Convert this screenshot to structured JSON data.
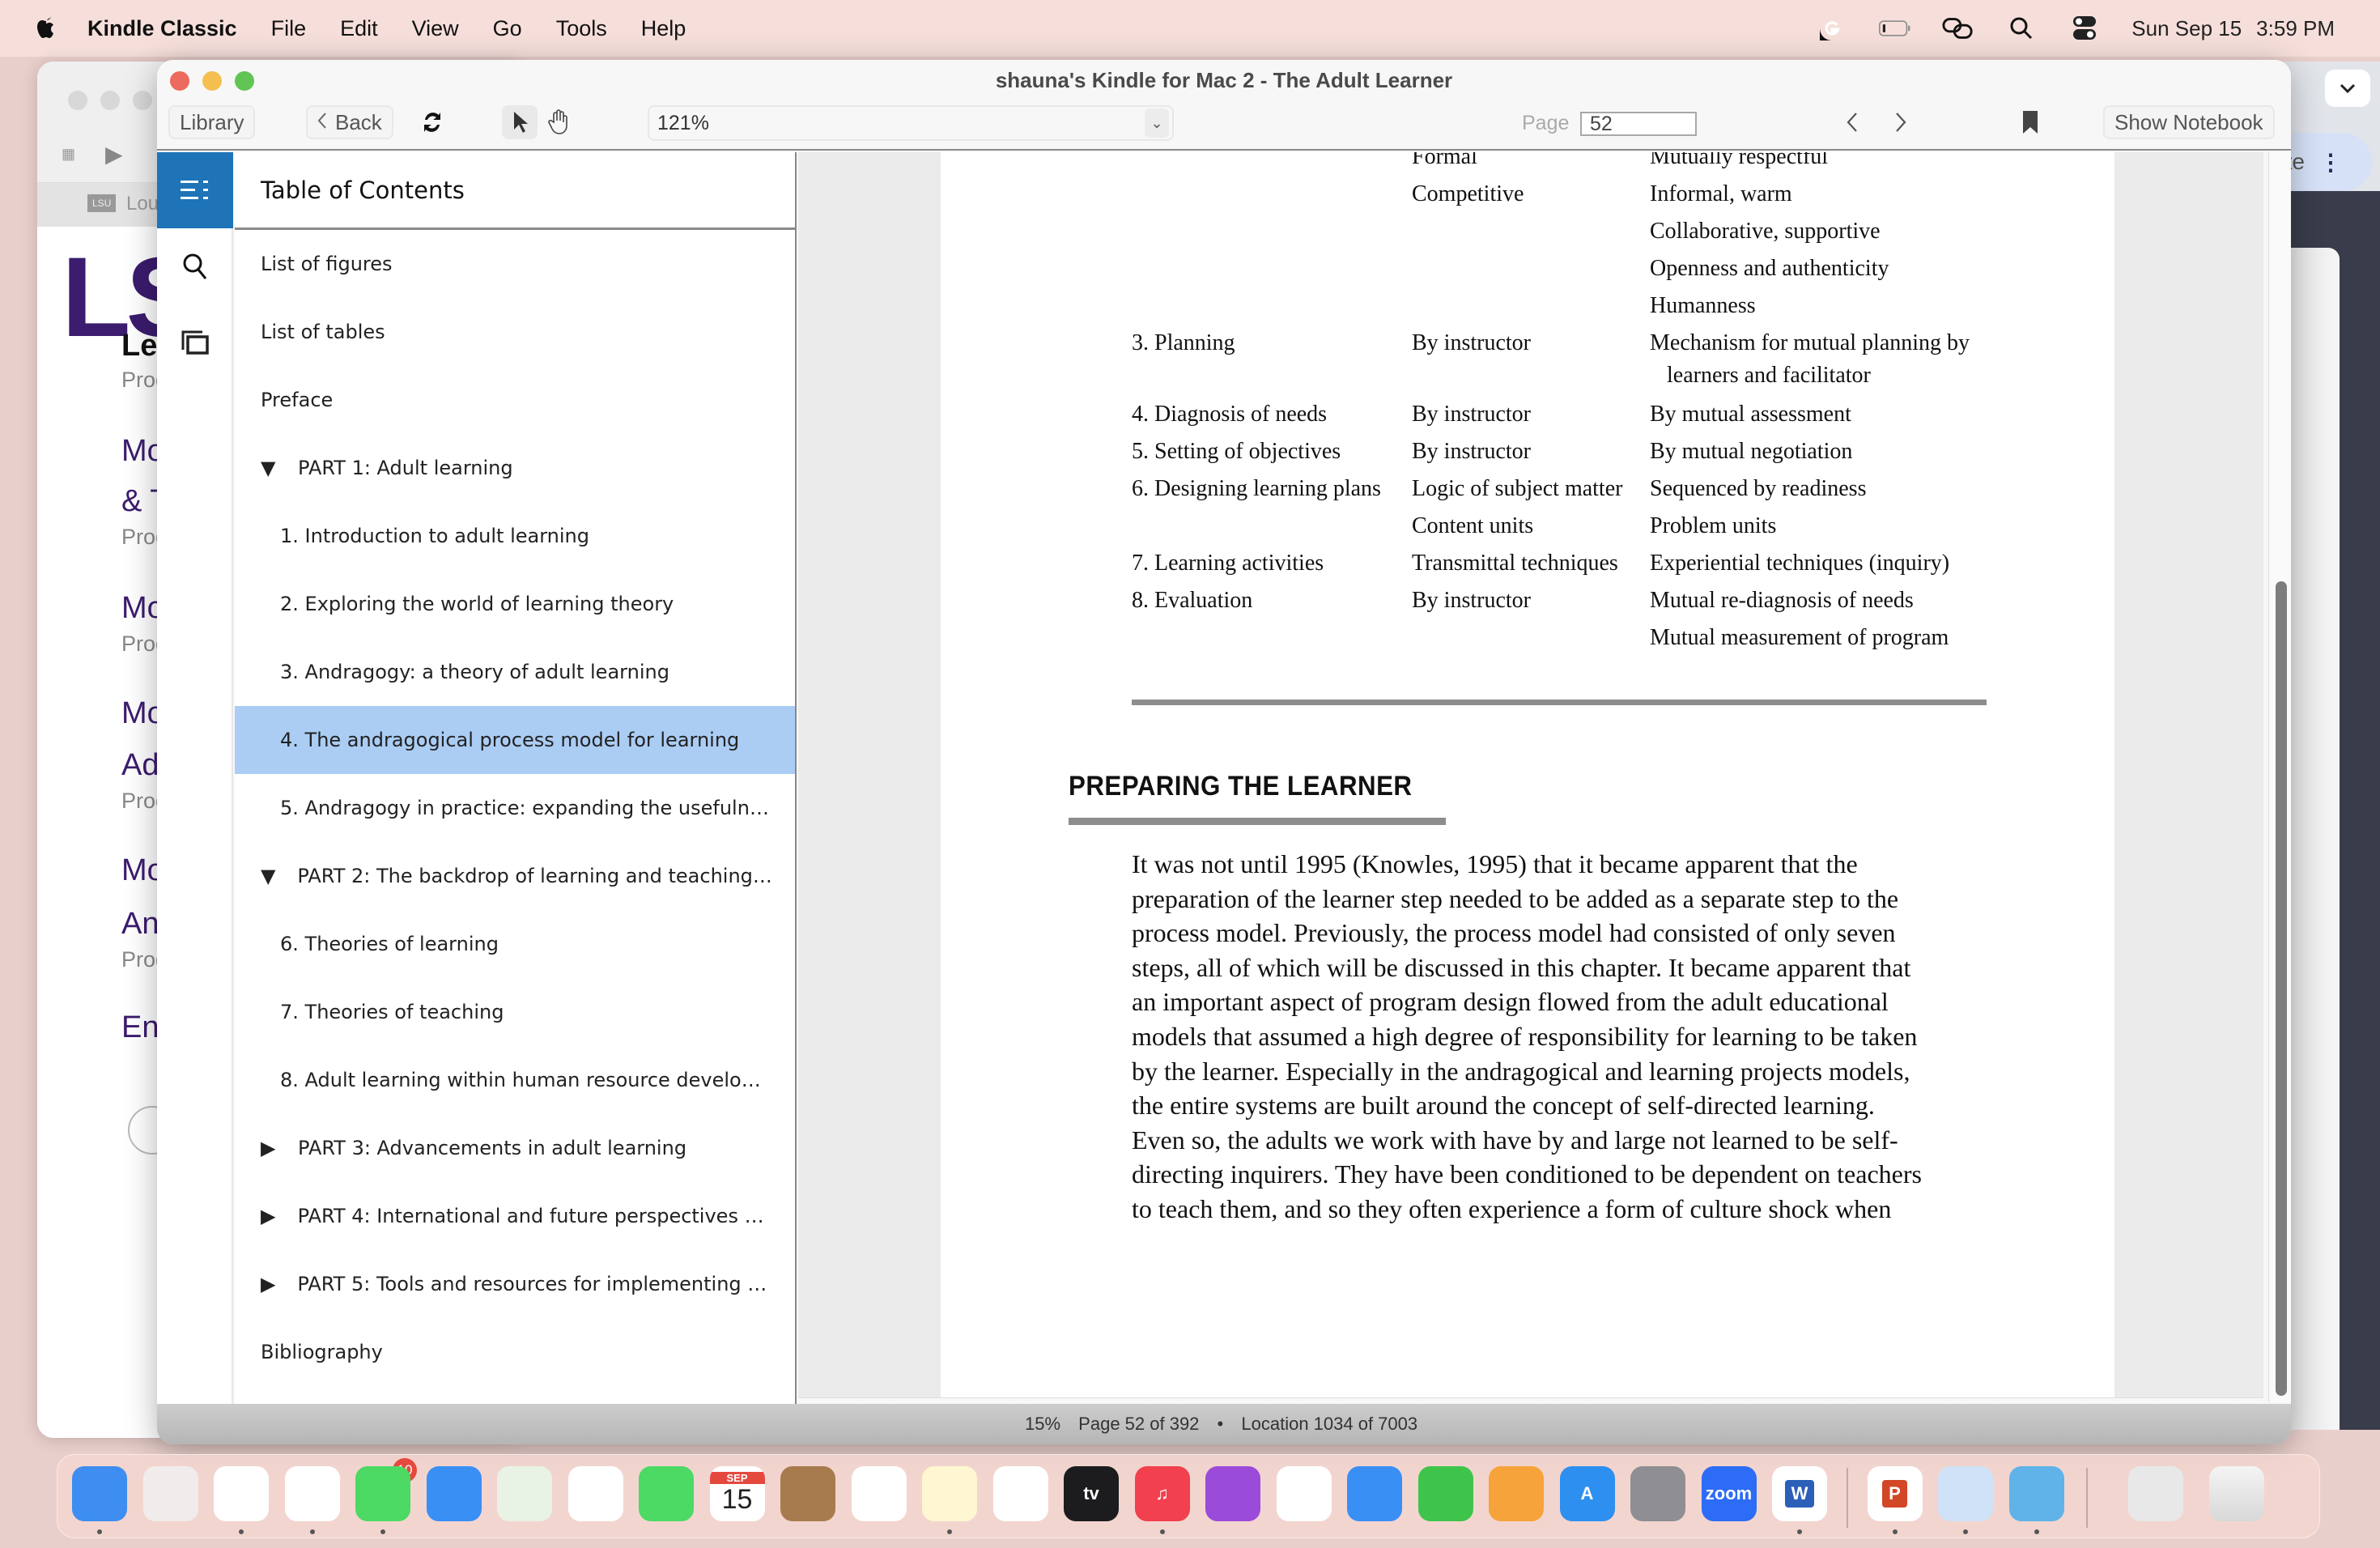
{
  "menubar": {
    "app_name": "Kindle Classic",
    "menus": [
      "File",
      "Edit",
      "View",
      "Go",
      "Tools",
      "Help"
    ],
    "status_icons": [
      "grammarly-icon",
      "battery-icon",
      "screen-mirror-icon",
      "spotlight-search-icon",
      "control-center-icon"
    ],
    "date": "Sun Sep 15",
    "time": "3:59 PM"
  },
  "background_window_left": {
    "tab_label": "Loui",
    "logo_text": "LS",
    "links": [
      {
        "title": "Le",
        "sub": "Prog"
      },
      {
        "title": "Mo",
        "sub": ""
      },
      {
        "title": "& T",
        "sub": "Prog"
      },
      {
        "title": "Mo",
        "sub": "Prog"
      },
      {
        "title": "Mo",
        "sub": ""
      },
      {
        "title": "Ad",
        "sub": "Prog"
      },
      {
        "title": "Mo",
        "sub": ""
      },
      {
        "title": "An",
        "sub": "Prog"
      },
      {
        "title": "En",
        "sub": ""
      }
    ]
  },
  "background_window_right": {
    "pill_text": "ate"
  },
  "window": {
    "title": "shauna's Kindle for Mac 2 - The Adult Learner"
  },
  "toolbar": {
    "library_label": "Library",
    "back_label": "Back",
    "zoom_value": "121%",
    "page_label": "Page",
    "page_value": "52",
    "show_notebook_label": "Show Notebook"
  },
  "toc": {
    "header": "Table of Contents",
    "items": [
      {
        "label": "List of figures",
        "level": 0,
        "toggle": ""
      },
      {
        "label": "List of tables",
        "level": 0,
        "toggle": ""
      },
      {
        "label": "Preface",
        "level": 0,
        "toggle": ""
      },
      {
        "label": "PART 1: Adult learning",
        "level": 0,
        "toggle": "▼"
      },
      {
        "label": "1. Introduction to adult learning",
        "level": 1,
        "toggle": ""
      },
      {
        "label": "2. Exploring the world of learning theory",
        "level": 1,
        "toggle": ""
      },
      {
        "label": "3. Andragogy: a theory of adult learning",
        "level": 1,
        "toggle": ""
      },
      {
        "label": "4. The andragogical process model for learning",
        "level": 1,
        "toggle": "",
        "selected": true
      },
      {
        "label": "5. Andragogy in practice: expanding the usefulne…",
        "level": 1,
        "toggle": ""
      },
      {
        "label": "PART 2: The backdrop of learning and teaching …",
        "level": 0,
        "toggle": "▼"
      },
      {
        "label": "6. Theories of learning",
        "level": 1,
        "toggle": ""
      },
      {
        "label": "7. Theories of teaching",
        "level": 1,
        "toggle": ""
      },
      {
        "label": "8. Adult learning within human resource develop…",
        "level": 1,
        "toggle": ""
      },
      {
        "label": "PART 3: Advancements in adult learning",
        "level": 0,
        "toggle": "▶"
      },
      {
        "label": "PART 4: International and future perspectives o…",
        "level": 0,
        "toggle": "▶"
      },
      {
        "label": "PART 5: Tools and resources for implementing a…",
        "level": 0,
        "toggle": "▶"
      },
      {
        "label": "Bibliography",
        "level": 0,
        "toggle": ""
      }
    ]
  },
  "page_content": {
    "table_rows": [
      {
        "c1": "",
        "c2": "Formal",
        "c3": "Mutually respectful"
      },
      {
        "c1": "",
        "c2": "Competitive",
        "c3": "Informal, warm"
      },
      {
        "c1": "",
        "c2": "",
        "c3": "Collaborative, supportive"
      },
      {
        "c1": "",
        "c2": "",
        "c3": "Openness and authenticity"
      },
      {
        "c1": "",
        "c2": "",
        "c3": "Humanness"
      },
      {
        "c1": "3. Planning",
        "c2": "By instructor",
        "c3": "Mechanism for mutual planning by"
      },
      {
        "c1": "",
        "c2": "",
        "c3": "   learners and facilitator"
      },
      {
        "c1": "4. Diagnosis of needs",
        "c2": "By instructor",
        "c3": "By mutual assessment"
      },
      {
        "c1": "5. Setting of objectives",
        "c2": "By instructor",
        "c3": "By mutual negotiation"
      },
      {
        "c1": "6. Designing learning plans",
        "c2": "Logic of subject matter",
        "c3": "Sequenced by readiness"
      },
      {
        "c1": "",
        "c2": "Content units",
        "c3": "Problem units"
      },
      {
        "c1": "7. Learning activities",
        "c2": "Transmittal techniques",
        "c3": "Experiential techniques (inquiry)"
      },
      {
        "c1": "8. Evaluation",
        "c2": "By instructor",
        "c3": "Mutual re-diagnosis of needs"
      },
      {
        "c1": "",
        "c2": "",
        "c3": "Mutual measurement of program"
      }
    ],
    "section_heading": "PREPARING THE LEARNER",
    "paragraph_lines": [
      "It was not until 1995 (Knowles, 1995) that it became apparent that the",
      "preparation of the learner step needed to be added as a separate step to the",
      "process model. Previously, the process model had consisted of only seven",
      "steps, all of which will be discussed in this chapter. It became apparent that",
      "an important aspect of program design flowed from the adult educational",
      "models that assumed a high degree of responsibility for learning to be taken",
      "by the learner. Especially in the andragogical and learning projects models,",
      "the entire systems are built around the concept of self-directed learning.",
      "Even so, the adults we work with have by and large not learned to be self-",
      "directing inquirers. They have been conditioned to be dependent on teachers",
      "to teach them, and so they often experience a form of culture shock when"
    ]
  },
  "status": {
    "percent": "15%",
    "page": "Page 52 of 392",
    "separator": "•",
    "location": "Location 1034 of 7003",
    "progress_fraction": 0.15
  },
  "colors": {
    "accent": "#1f73b7",
    "toc_selected": "#abcdf4"
  },
  "dock": {
    "apps": [
      {
        "name": "finder",
        "label": "",
        "color": "#3d8ef0",
        "running": true
      },
      {
        "name": "launchpad",
        "label": "",
        "color": "#f1ecec",
        "running": false
      },
      {
        "name": "safari",
        "label": "",
        "color": "#ffffff",
        "running": true
      },
      {
        "name": "chrome",
        "label": "",
        "color": "#ffffff",
        "running": true
      },
      {
        "name": "messages",
        "label": "",
        "color": "#4cd964",
        "running": true,
        "badge": "10"
      },
      {
        "name": "mail",
        "label": "",
        "color": "#3a8ff5",
        "running": false
      },
      {
        "name": "maps",
        "label": "",
        "color": "#e8f2e5",
        "running": false
      },
      {
        "name": "photos",
        "label": "",
        "color": "#ffffff",
        "running": false
      },
      {
        "name": "facetime",
        "label": "",
        "color": "#4cd964",
        "running": false
      },
      {
        "name": "calendar",
        "label": "15",
        "month": "SEP",
        "color": "#ffffff",
        "running": false
      },
      {
        "name": "contacts",
        "label": "",
        "color": "#a77b4d",
        "running": false
      },
      {
        "name": "reminders",
        "label": "",
        "color": "#ffffff",
        "running": false
      },
      {
        "name": "notes",
        "label": "",
        "color": "#fff7d1",
        "running": true
      },
      {
        "name": "freeform",
        "label": "",
        "color": "#ffffff",
        "running": false
      },
      {
        "name": "apple-tv",
        "label": "tv",
        "color": "#1c1c1e",
        "running": false
      },
      {
        "name": "music",
        "label": "♫",
        "color": "#f2404f",
        "running": true
      },
      {
        "name": "podcasts",
        "label": "",
        "color": "#9b4bd9",
        "running": false
      },
      {
        "name": "news",
        "label": "",
        "color": "#ffffff",
        "running": false
      },
      {
        "name": "keynote",
        "label": "",
        "color": "#3a8ff5",
        "running": false
      },
      {
        "name": "numbers",
        "label": "",
        "color": "#3fc44b",
        "running": false
      },
      {
        "name": "pages",
        "label": "",
        "color": "#f6a33b",
        "running": false
      },
      {
        "name": "app-store",
        "label": "A",
        "color": "#2d8ff0",
        "running": false
      },
      {
        "name": "system-settings",
        "label": "",
        "color": "#8e8e93",
        "running": false
      },
      {
        "name": "zoom",
        "label": "zoom",
        "color": "#2d6cf6",
        "running": false
      },
      {
        "name": "word",
        "label": "W",
        "color": "#ffffff",
        "running": true
      },
      {
        "name": "powerpoint",
        "label": "P",
        "color": "#ffffff",
        "running": true
      },
      {
        "name": "preview",
        "label": "",
        "color": "#cfe2f7",
        "running": true
      },
      {
        "name": "kindle",
        "label": "",
        "color": "#5fb3e8",
        "running": true
      }
    ],
    "trash": "trash-icon"
  }
}
